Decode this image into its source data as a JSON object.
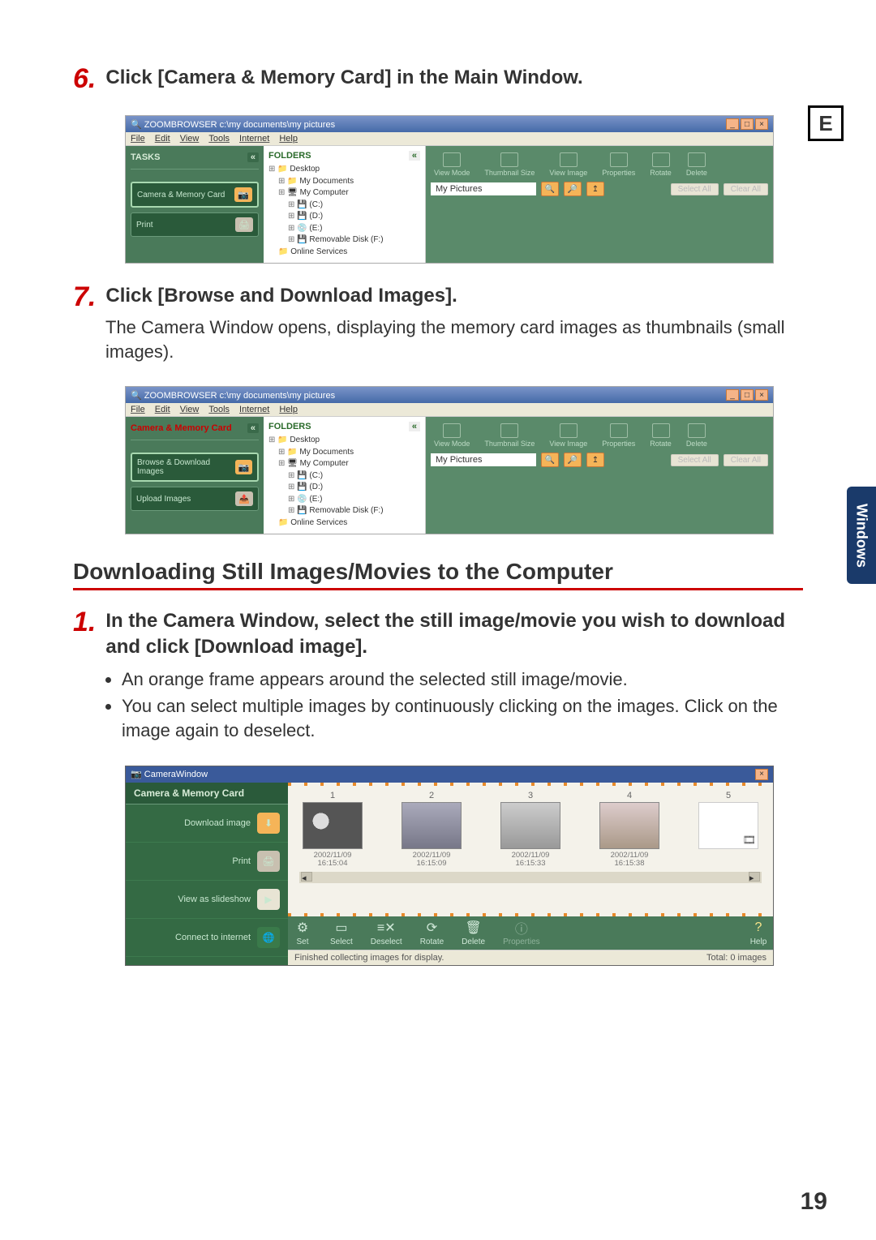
{
  "page": {
    "letter_marker": "E",
    "side_tab": "Windows",
    "number": "19"
  },
  "step6": {
    "num": "6.",
    "head": "Click [Camera & Memory Card] in the Main Window."
  },
  "step7": {
    "num": "7.",
    "head": "Click [Browse and Download Images].",
    "body": "The Camera Window opens, displaying the memory card images as thumbnails (small images)."
  },
  "section_title": "Downloading Still Images/Movies to the Computer",
  "step1": {
    "num": "1.",
    "head": "In the Camera Window, select the still image/movie you wish to download and click [Download image].",
    "bullet1": "An orange frame appears around the selected still image/movie.",
    "bullet2": "You can select multiple images by continuously clicking on the images. Click on the image again to deselect."
  },
  "zb_common": {
    "title": "ZOOMBROWSER c:\\my documents\\my pictures",
    "menus": {
      "file": "File",
      "edit": "Edit",
      "view": "View",
      "tools": "Tools",
      "internet": "Internet",
      "help": "Help"
    },
    "tasks_hdr": "TASKS",
    "fold_hdr": "FOLDERS",
    "path": "My Pictures",
    "btn_select_all": "Select All",
    "btn_clear_all": "Clear All",
    "tree": {
      "desktop": "Desktop",
      "mydocs": "My Documents",
      "mycomp": "My Computer",
      "c": "(C:)",
      "d": "(D:)",
      "e": "(E:)",
      "remov": "Removable Disk (F:)",
      "online": "Online Services"
    },
    "toolbar": {
      "view_mode": "View Mode",
      "thumb_size": "Thumbnail Size",
      "view_image": "View Image",
      "properties": "Properties",
      "rotate": "Rotate",
      "delete": "Delete"
    }
  },
  "zb6": {
    "task_camera": "Camera & Memory Card",
    "task_print": "Print"
  },
  "zb7": {
    "task_camera": "Camera & Memory Card",
    "task_browse": "Browse & Download Images",
    "task_upload": "Upload Images"
  },
  "cw": {
    "title": "CameraWindow",
    "hdr": "Camera & Memory Card",
    "items": {
      "download": "Download image",
      "print": "Print",
      "slideshow": "View as slideshow",
      "connect": "Connect to internet"
    },
    "thumbs": [
      {
        "n": "1",
        "date": "2002/11/09",
        "time": "16:15:04"
      },
      {
        "n": "2",
        "date": "2002/11/09",
        "time": "16:15:09"
      },
      {
        "n": "3",
        "date": "2002/11/09",
        "time": "16:15:33"
      },
      {
        "n": "4",
        "date": "2002/11/09",
        "time": "16:15:38"
      },
      {
        "n": "5",
        "date": "",
        "time": ""
      }
    ],
    "toolbar": {
      "set": "Set",
      "select": "Select",
      "deselect": "Deselect",
      "rotate": "Rotate",
      "delete": "Delete",
      "properties": "Properties",
      "help": "Help"
    },
    "status_left": "Finished collecting images for display.",
    "status_right": "Total: 0 images"
  }
}
